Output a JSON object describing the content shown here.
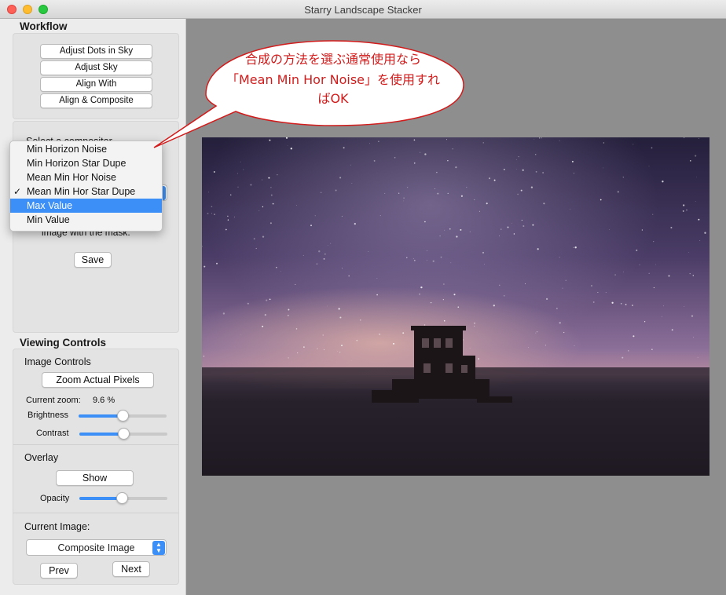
{
  "window": {
    "title": "Starry Landscape Stacker"
  },
  "workflow": {
    "title": "Workflow",
    "buttons": [
      "Adjust Dots in Sky",
      "Adjust Sky",
      "Align With",
      "Align & Composite"
    ]
  },
  "composite_panel": {
    "hidden_label": "Select a compositor",
    "mask_text": "image with the mask.",
    "save_label": "Save"
  },
  "compositor_menu": {
    "items": [
      "Min Horizon Noise",
      "Min Horizon Star Dupe",
      "Mean Min Hor Noise",
      "Mean Min Hor Star Dupe",
      "Max Value",
      "Min Value"
    ],
    "checked": "Mean Min Hor Star Dupe",
    "highlighted": "Max Value"
  },
  "viewing_controls": {
    "title": "Viewing Controls",
    "image_controls": {
      "title": "Image Controls",
      "zoom_button": "Zoom Actual Pixels",
      "zoom_label": "Current zoom:",
      "zoom_value": "9.6 %",
      "brightness_label": "Brightness",
      "brightness": 0.5,
      "contrast_label": "Contrast",
      "contrast": 0.5
    },
    "overlay": {
      "title": "Overlay",
      "show_button": "Show",
      "opacity_label": "Opacity",
      "opacity": 0.48
    },
    "current_image": {
      "title": "Current Image:",
      "selected": "Composite Image",
      "prev_label": "Prev",
      "next_label": "Next"
    }
  },
  "annotation": {
    "lines": [
      "合成の方法を選ぶ通常使用なら",
      "「Mean Min Hor Noise」を使用すれ",
      "ばOK"
    ],
    "color": "#d21b1b"
  },
  "colors": {
    "accent": "#3b8ff7",
    "viewer_bg": "#8e8e8e"
  }
}
